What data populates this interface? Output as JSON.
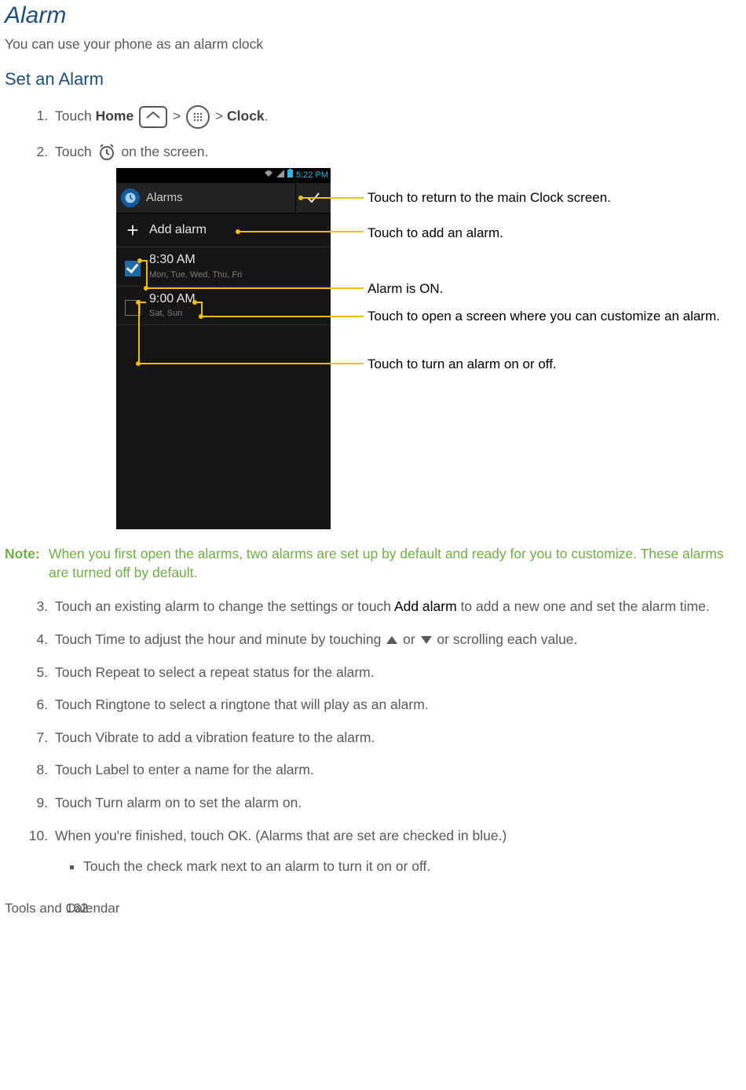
{
  "heading": "Alarm",
  "subtitle": "You can use your phone as an alarm clock",
  "section": "Set an Alarm",
  "step1": {
    "a": "Touch ",
    "home": "Home",
    "sep": " > ",
    "clock": "Clock",
    "end": "."
  },
  "step2": {
    "a": "Touch ",
    "b": " on the screen."
  },
  "phone": {
    "time": "5:22 PM",
    "alarms_label": "Alarms",
    "add_label": "Add alarm",
    "rows": [
      {
        "time": "8:30 AM",
        "days": "Mon, Tue, Wed, Thu, Fri",
        "checked": true
      },
      {
        "time": "9:00 AM",
        "days": "Sat, Sun",
        "checked": false
      }
    ]
  },
  "callouts": {
    "c1": "Touch to return to the main Clock screen.",
    "c2": "Touch to add an alarm.",
    "c3": "Alarm is ON.",
    "c4": "Touch to open a screen where you can customize an alarm.",
    "c5": "Touch to turn an alarm on or off."
  },
  "note": {
    "label": "Note:",
    "text": "When you first open the alarms, two alarms are set up by default and ready for you to customize. These alarms are turned off by default."
  },
  "step3": {
    "a": "Touch an existing alarm to change the settings or touch ",
    "add": "Add alarm",
    "b": " to add a new one and set the alarm time."
  },
  "step4": {
    "a": "Touch Time to adjust the hour and minute by touching ",
    "or": " or ",
    "b": " or scrolling each value."
  },
  "step5": "Touch Repeat to select a repeat status for the alarm.",
  "step6": "Touch Ringtone to select a ringtone that will play as an alarm.",
  "step7": "Touch Vibrate to add a vibration feature to the alarm.",
  "step8": "Touch Label to enter a name for the alarm.",
  "step9": "Touch Turn alarm on to set the alarm on.",
  "step10": "When you're finished, touch OK. (Alarms that are set are checked in blue.)",
  "step10_sub": "Touch the check mark next to an alarm to turn it on or off.",
  "footer": {
    "section": "Tools and Calendar",
    "page": "162"
  }
}
